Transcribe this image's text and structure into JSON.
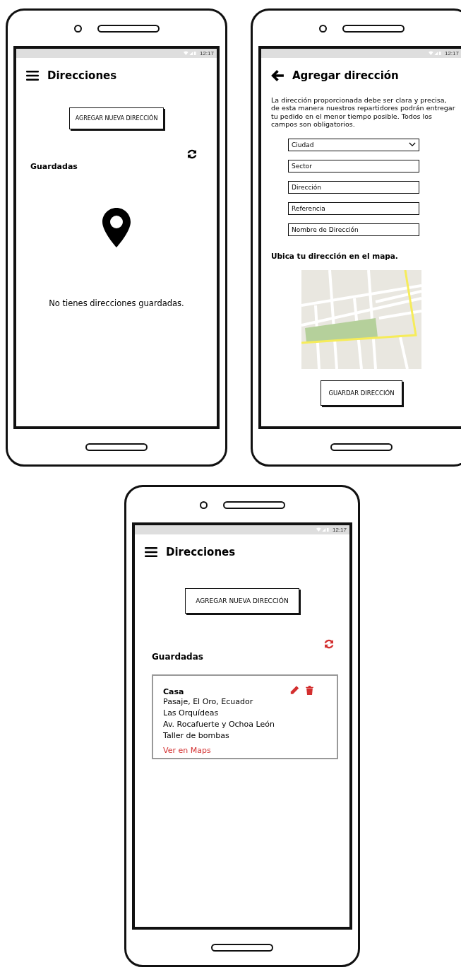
{
  "phones": [
    {
      "kind": "addresses",
      "status_time": "12:17",
      "title": "Direcciones",
      "add_button": "AGREGAR NUEVA DIRECCIÓN",
      "refresh_highlighted": false,
      "section": "Guardadas",
      "empty_message": "No tienes direcciones guardadas."
    },
    {
      "kind": "form",
      "status_time": "12:17",
      "title": "Agregar dirección",
      "intro": "La dirección proporcionada debe ser clara y precisa, de esta manera nuestros repartidores podrán entregar tu pedido en el menor tiempo posible. Todos los campos son obligatorios.",
      "fields": [
        {
          "kind": "select",
          "placeholder": "Ciudad"
        },
        {
          "kind": "text",
          "placeholder": "Sector"
        },
        {
          "kind": "text",
          "placeholder": "Dirección"
        },
        {
          "kind": "text",
          "placeholder": "Referencia"
        },
        {
          "kind": "text",
          "placeholder": "Nombre de Dirección"
        }
      ],
      "map_label": "Ubica tu dirección en el mapa.",
      "save_button": "GUARDAR DIRECCIÓN"
    },
    {
      "kind": "addresses",
      "status_time": "12:17",
      "title": "Direcciones",
      "add_button": "AGREGAR NUEVA DIRECCIÓN",
      "refresh_highlighted": true,
      "section": "Guardadas",
      "addresses": [
        {
          "name": "Casa",
          "lines": [
            "Pasaje, El Oro, Ecuador",
            "Las Orquídeas",
            "Av. Rocafuerte y Ochoa León",
            "Taller de bombas"
          ],
          "link": "Ver en Maps"
        }
      ]
    }
  ]
}
